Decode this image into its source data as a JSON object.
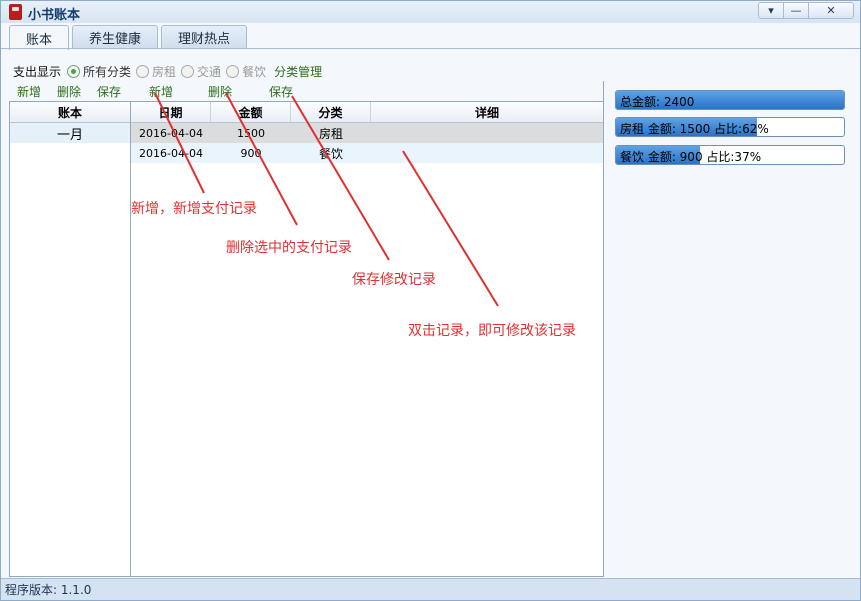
{
  "window": {
    "title": "小书账本",
    "controls": {
      "dropdown": "▾",
      "minimize": "—",
      "close": "✕"
    }
  },
  "tabs": [
    {
      "label": "账本",
      "active": true
    },
    {
      "label": "养生健康",
      "active": false
    },
    {
      "label": "理财热点",
      "active": false
    }
  ],
  "filter": {
    "title": "支出显示",
    "options": [
      {
        "label": "所有分类",
        "checked": true
      },
      {
        "label": "房租",
        "checked": false
      },
      {
        "label": "交通",
        "checked": false
      },
      {
        "label": "餐饮",
        "checked": false
      }
    ],
    "manage_label": "分类管理"
  },
  "ledger_actions": {
    "add": "新增",
    "delete": "删除",
    "save": "保存"
  },
  "record_actions": {
    "add": "新增",
    "delete": "删除",
    "save": "保存"
  },
  "ledger_list": {
    "header": "账本",
    "items": [
      "一月"
    ]
  },
  "records": {
    "columns": [
      "日期",
      "金额",
      "分类",
      "详细"
    ],
    "rows": [
      {
        "date": "2016-04-04",
        "amount": "1500",
        "category": "房租",
        "detail": ""
      },
      {
        "date": "2016-04-04",
        "amount": "900",
        "category": "餐饮",
        "detail": ""
      }
    ]
  },
  "summary": {
    "total": {
      "label": "总金额: 2400",
      "fill_fraction": 1.0
    },
    "items": [
      {
        "label": "房租 金额: 1500 占比:62%",
        "fill_fraction": 0.62
      },
      {
        "label": "餐饮 金额: 900 占比:37%",
        "fill_fraction": 0.37
      }
    ]
  },
  "annotations": [
    "新增，新增支付记录",
    "删除选中的支付记录",
    "保存修改记录",
    "双击记录，即可修改该记录"
  ],
  "status": {
    "version": "程序版本: 1.1.0"
  },
  "colors": {
    "accent_green": "#2d6b1e",
    "annotation_red": "#e03030",
    "bar_blue": "#2873c9"
  }
}
